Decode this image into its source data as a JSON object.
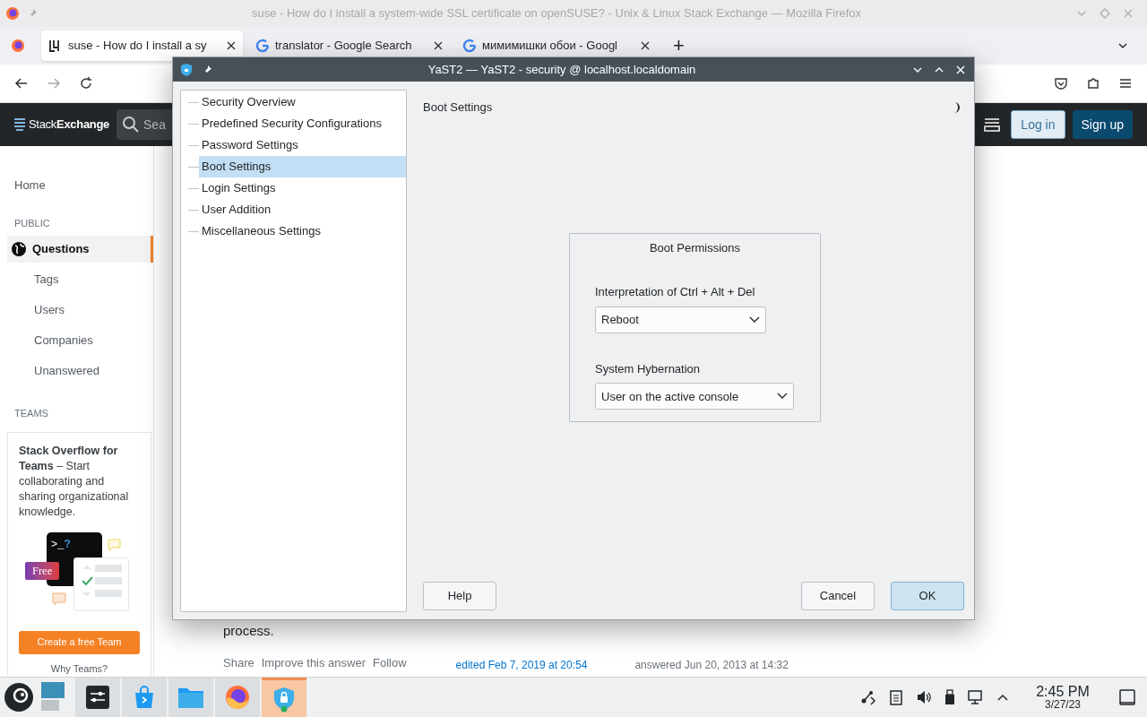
{
  "browser": {
    "window_title": "suse - How do I install a system-wide SSL certificate on openSUSE? - Unix & Linux Stack Exchange — Mozilla Firefox",
    "tabs": [
      {
        "label": "suse - How do I install a sy",
        "selected": true,
        "kind": "site"
      },
      {
        "label": "translator - Google Search",
        "selected": false,
        "kind": "google"
      },
      {
        "label": "мимимишки обои - Googl",
        "selected": false,
        "kind": "google"
      }
    ],
    "new_tab": "+"
  },
  "site_header": {
    "logo": "Stack**Exchange**",
    "search": {
      "placeholder": "Sea"
    },
    "login": "Log in",
    "signup": "Sign up"
  },
  "site_sidebar": {
    "home": "Home",
    "sections": [
      {
        "heading": "PUBLIC",
        "items": [
          {
            "label": "Questions",
            "selected": true,
            "kind": "main"
          },
          {
            "label": "Tags",
            "selected": false,
            "kind": "sub"
          },
          {
            "label": "Users",
            "selected": false,
            "kind": "sub"
          },
          {
            "label": "Companies",
            "selected": false,
            "kind": "sub"
          },
          {
            "label": "Unanswered",
            "selected": false,
            "kind": "sub"
          }
        ]
      },
      {
        "heading": "TEAMS"
      }
    ],
    "teams_card": {
      "text": "**Stack Overflow for Teams** – Start collaborating and sharing organizational knowledge.",
      "terminal": ">_",
      "question": "?",
      "badge": "Free",
      "button": "Create a free Team",
      "link": "Why Teams?"
    }
  },
  "post": {
    "text_tail": "process.",
    "actions": [
      "Share",
      "Improve this answer",
      "Follow"
    ],
    "edited": "edited Feb 7, 2019 at 20:54",
    "answered": "answered Jun 20, 2013 at 14:32"
  },
  "dialog": {
    "title": "YaST2 — YaST2 - security @ localhost.localdomain",
    "tree": [
      {
        "label": "Security Overview",
        "selected": false
      },
      {
        "label": "Predefined Security Configurations",
        "selected": false
      },
      {
        "label": "Password Settings",
        "selected": false
      },
      {
        "label": "Boot Settings",
        "selected": true
      },
      {
        "label": "Login Settings",
        "selected": false
      },
      {
        "label": "User Addition",
        "selected": false
      },
      {
        "label": "Miscellaneous Settings",
        "selected": false
      }
    ],
    "heading": "Boot Settings",
    "group": {
      "title": "Boot Permissions",
      "fields": [
        {
          "label": "Interpretation of Ctrl + Alt + Del",
          "value": "Reboot",
          "kind": "short"
        },
        {
          "label": "System Hybernation",
          "value": "User on the active console",
          "kind": "wide"
        }
      ]
    },
    "buttons": [
      {
        "label": "Help",
        "primary": false
      },
      {
        "label": "Cancel",
        "primary": false
      },
      {
        "label": "OK",
        "primary": true
      }
    ]
  },
  "taskbar": {
    "tasks": [
      {
        "kind": "settings",
        "active": false
      },
      {
        "kind": "store",
        "active": false
      },
      {
        "kind": "files",
        "active": false
      },
      {
        "kind": "firefox",
        "active": false
      },
      {
        "kind": "yast",
        "active": true
      }
    ],
    "time": "2:45 PM",
    "date": "3/27/23"
  }
}
